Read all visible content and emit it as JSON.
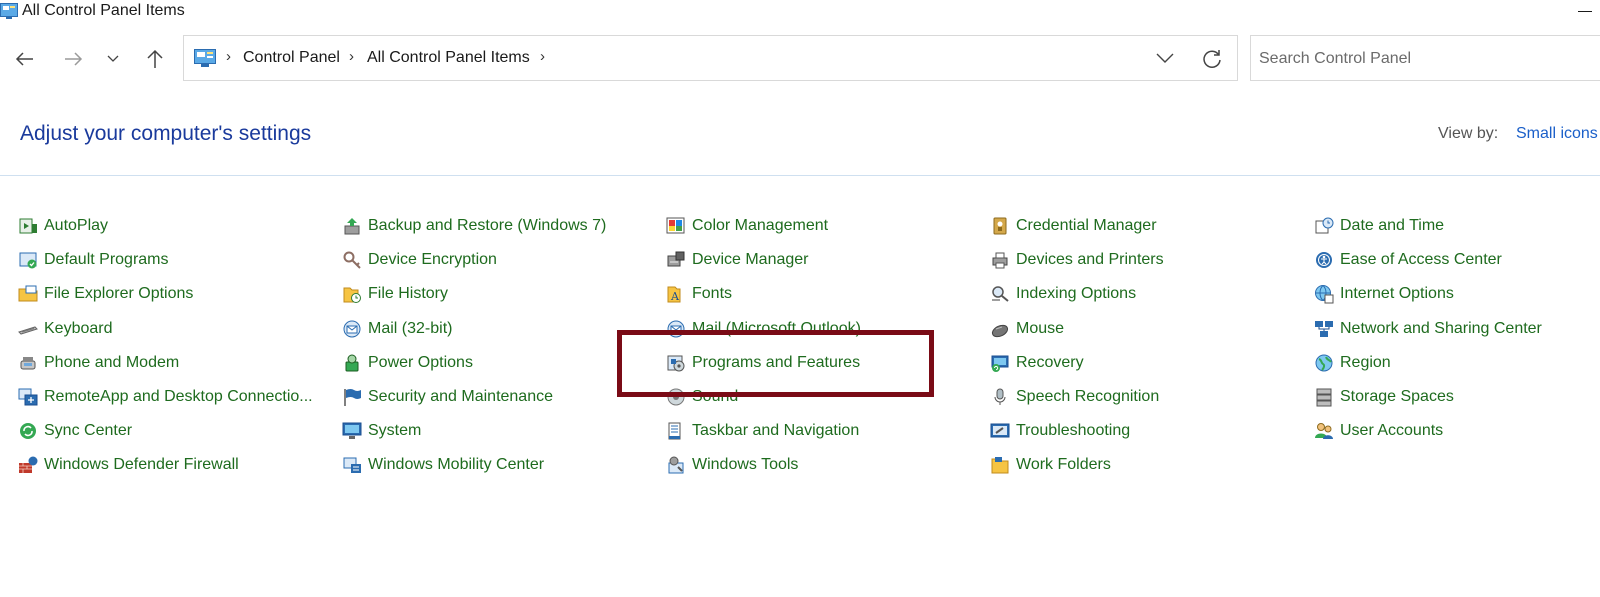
{
  "window": {
    "title": "All Control Panel Items"
  },
  "address": {
    "crumbs": [
      "Control Panel",
      "All Control Panel Items"
    ],
    "sep": "›"
  },
  "search": {
    "placeholder": "Search Control Panel",
    "value": ""
  },
  "header": {
    "title": "Adjust your computer's settings",
    "view_by_label": "View by:",
    "view_by_value": "Small icons"
  },
  "colors": {
    "link_green": "#1e6b1e",
    "title_blue": "#1a3a9c",
    "highlight": "#7a0b16"
  },
  "columns": [
    [
      {
        "label": "AutoPlay",
        "icon": "autoplay-icon"
      },
      {
        "label": "Default Programs",
        "icon": "default-programs-icon"
      },
      {
        "label": "File Explorer Options",
        "icon": "folder-options-icon"
      },
      {
        "label": "Keyboard",
        "icon": "keyboard-icon"
      },
      {
        "label": "Phone and Modem",
        "icon": "phone-icon"
      },
      {
        "label": "RemoteApp and Desktop Connectio...",
        "icon": "remoteapp-icon"
      },
      {
        "label": "Sync Center",
        "icon": "sync-icon"
      },
      {
        "label": "Windows Defender Firewall",
        "icon": "firewall-icon"
      }
    ],
    [
      {
        "label": "Backup and Restore (Windows 7)",
        "icon": "backup-icon"
      },
      {
        "label": "Device Encryption",
        "icon": "encryption-key-icon"
      },
      {
        "label": "File History",
        "icon": "file-history-icon"
      },
      {
        "label": "Mail (32-bit)",
        "icon": "mail-icon"
      },
      {
        "label": "Power Options",
        "icon": "power-icon"
      },
      {
        "label": "Security and Maintenance",
        "icon": "flag-icon"
      },
      {
        "label": "System",
        "icon": "monitor-icon"
      },
      {
        "label": "Windows Mobility Center",
        "icon": "mobility-icon"
      }
    ],
    [
      {
        "label": "Color Management",
        "icon": "color-management-icon"
      },
      {
        "label": "Device Manager",
        "icon": "device-manager-icon"
      },
      {
        "label": "Fonts",
        "icon": "fonts-icon"
      },
      {
        "label": "Mail (Microsoft Outlook)",
        "icon": "mail-icon"
      },
      {
        "label": "Programs and Features",
        "icon": "programs-icon"
      },
      {
        "label": "Sound",
        "icon": "speaker-icon"
      },
      {
        "label": "Taskbar and Navigation",
        "icon": "taskbar-icon"
      },
      {
        "label": "Windows Tools",
        "icon": "tools-icon"
      }
    ],
    [
      {
        "label": "Credential Manager",
        "icon": "credential-icon"
      },
      {
        "label": "Devices and Printers",
        "icon": "printer-icon"
      },
      {
        "label": "Indexing Options",
        "icon": "indexing-icon"
      },
      {
        "label": "Mouse",
        "icon": "mouse-icon"
      },
      {
        "label": "Recovery",
        "icon": "recovery-icon"
      },
      {
        "label": "Speech Recognition",
        "icon": "microphone-icon"
      },
      {
        "label": "Troubleshooting",
        "icon": "troubleshooting-icon"
      },
      {
        "label": "Work Folders",
        "icon": "work-folders-icon"
      }
    ],
    [
      {
        "label": "Date and Time",
        "icon": "clock-icon"
      },
      {
        "label": "Ease of Access Center",
        "icon": "ease-of-access-icon"
      },
      {
        "label": "Internet Options",
        "icon": "globe-icon"
      },
      {
        "label": "Network and Sharing Center",
        "icon": "network-icon"
      },
      {
        "label": "Region",
        "icon": "region-globe-icon"
      },
      {
        "label": "Storage Spaces",
        "icon": "storage-icon"
      },
      {
        "label": "User Accounts",
        "icon": "users-icon"
      }
    ]
  ]
}
